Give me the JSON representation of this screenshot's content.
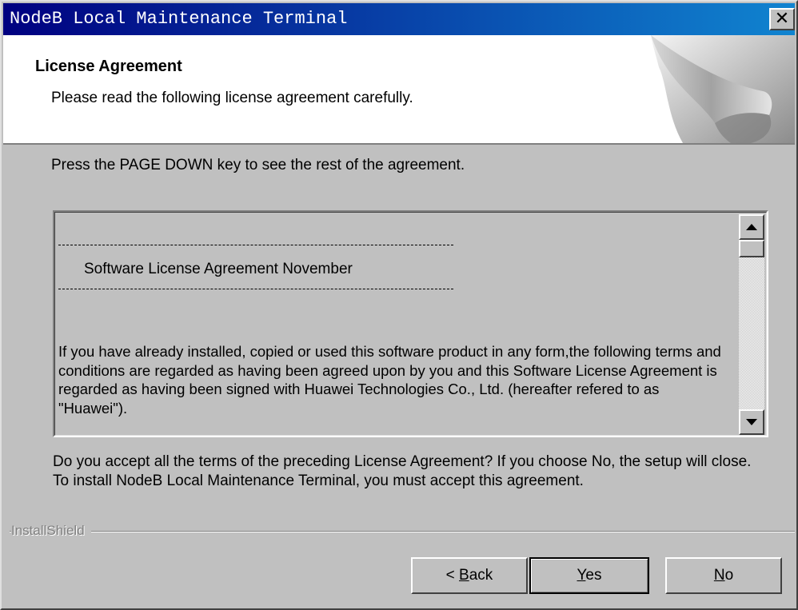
{
  "window": {
    "title": "NodeB Local Maintenance Terminal"
  },
  "header": {
    "title": "License Agreement",
    "subtitle": "Please read the following license agreement carefully."
  },
  "instruction": "Press the PAGE DOWN key to see the rest of the agreement.",
  "license": {
    "heading": "Software License Agreement November",
    "paragraph": "If you have already installed, copied or used this software product in any form,the following terms and conditions are regarded as having been agreed upon by you and this Software License Agreement is regarded as having been signed with Huawei Technologies Co., Ltd. (hereafter refered to as \"Huawei\")."
  },
  "question": "Do you accept all the terms of the preceding License Agreement?  If you choose No,  the setup will close.  To install NodeB Local Maintenance Terminal, you must accept this agreement.",
  "footer": {
    "brand": "InstallShield"
  },
  "buttons": {
    "back": {
      "prefix": "< ",
      "mnemonic": "B",
      "rest": "ack"
    },
    "yes": {
      "mnemonic": "Y",
      "rest": "es"
    },
    "no": {
      "mnemonic": "N",
      "rest": "o"
    }
  },
  "icons": {
    "close": "close-icon",
    "scroll_up": "arrow-up-icon",
    "scroll_down": "arrow-down-icon",
    "header_graphic": "installshield-page-curl-graphic"
  },
  "colors": {
    "titlebar_start": "#000080",
    "titlebar_end": "#1084d0",
    "face": "#c0c0c0"
  }
}
